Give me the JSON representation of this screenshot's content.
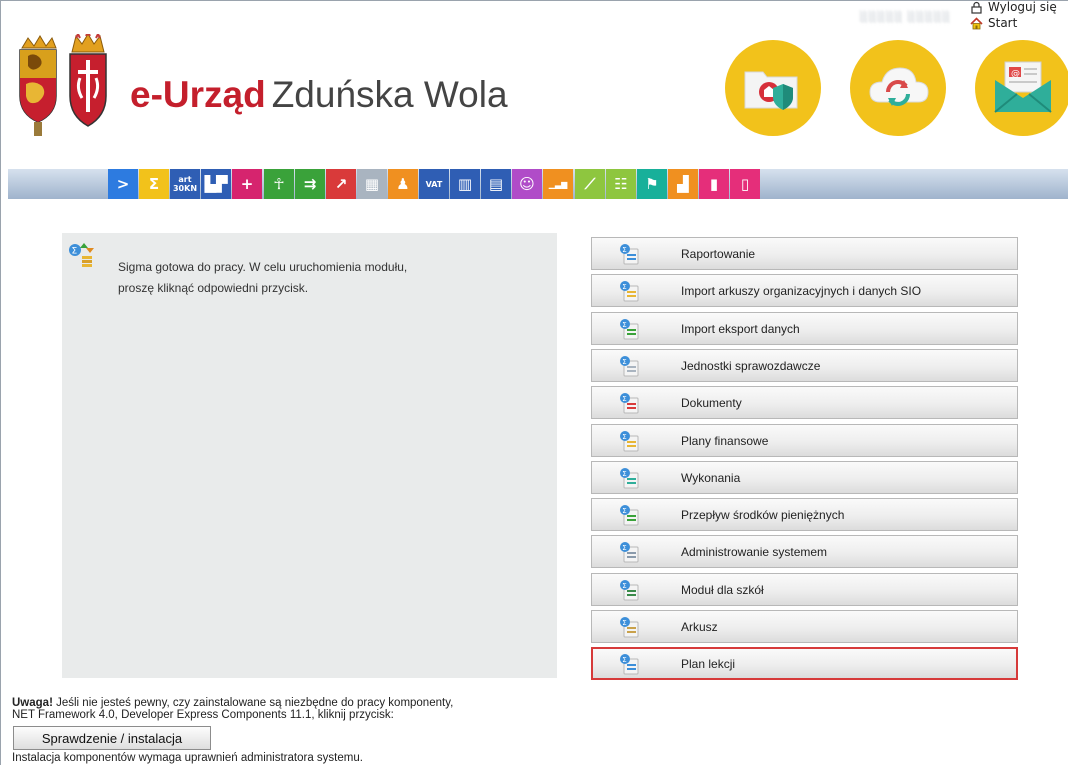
{
  "header": {
    "brand_main": "e-Urząd",
    "brand_city": "Zduńska Wola",
    "user_name": "░░░░░ ░░░░░",
    "logout_label": "Wyloguj się",
    "start_label": "Start",
    "circle_icons": [
      "secure-folder-icon",
      "cloud-sync-icon",
      "email-icon"
    ],
    "accent_color": "#f2c21b",
    "brand_color": "#c41f2c"
  },
  "toolbar": {
    "items": [
      {
        "name": "toolbar-arrow-button",
        "color": "#2d7be0",
        "glyph": ">"
      },
      {
        "name": "toolbar-sigma-button",
        "color": "#f2c21b",
        "glyph": "Σ"
      },
      {
        "name": "toolbar-art30kn-button",
        "color": "#2f5eb4",
        "glyph": "art 30KN"
      },
      {
        "name": "toolbar-buildings-button",
        "color": "#2f5eb4",
        "glyph": "▙▛"
      },
      {
        "name": "toolbar-plus-button",
        "color": "#d6246e",
        "glyph": "+"
      },
      {
        "name": "toolbar-people-button",
        "color": "#3aa23a",
        "glyph": "☥"
      },
      {
        "name": "toolbar-transfer-button",
        "color": "#3aa23a",
        "glyph": "⇉"
      },
      {
        "name": "toolbar-growth-button",
        "color": "#d93a3a",
        "glyph": "↗"
      },
      {
        "name": "toolbar-table-button",
        "color": "#a9b4c0",
        "glyph": "▦"
      },
      {
        "name": "toolbar-person-button",
        "color": "#f09020",
        "glyph": "♟"
      },
      {
        "name": "toolbar-vat-button",
        "color": "#2f5eb4",
        "glyph": "VAT"
      },
      {
        "name": "toolbar-book-button",
        "color": "#2f5eb4",
        "glyph": "▥"
      },
      {
        "name": "toolbar-book-search-button",
        "color": "#2f5eb4",
        "glyph": "▤"
      },
      {
        "name": "toolbar-kids-button",
        "color": "#b04cc8",
        "glyph": "☺"
      },
      {
        "name": "toolbar-bar-chart-button",
        "color": "#f09020",
        "glyph": "▁▃▆"
      },
      {
        "name": "toolbar-line-chart-button",
        "color": "#8ec63f",
        "glyph": "⟋"
      },
      {
        "name": "toolbar-list-button",
        "color": "#8ec63f",
        "glyph": "☷"
      },
      {
        "name": "toolbar-desk-button",
        "color": "#18b09a",
        "glyph": "⚑"
      },
      {
        "name": "toolbar-blocks-button",
        "color": "#f09020",
        "glyph": "▟"
      },
      {
        "name": "toolbar-label-button",
        "color": "#e52e7a",
        "glyph": "▮"
      },
      {
        "name": "toolbar-page-button",
        "color": "#e52e7a",
        "glyph": "▯"
      }
    ]
  },
  "info": {
    "line1": "Sigma gotowa do pracy. W celu uruchomienia modułu,",
    "line2": "proszę kliknąć odpowiedni przycisk."
  },
  "modules": [
    {
      "label": "Raportowanie",
      "icon": "report-icon"
    },
    {
      "label": "Import arkuszy organizacyjnych i danych SIO",
      "icon": "sio-import-icon"
    },
    {
      "label": "Import eksport danych",
      "icon": "import-export-icon"
    },
    {
      "label": "Jednostki sprawozdawcze",
      "icon": "units-icon"
    },
    {
      "label": "Dokumenty",
      "icon": "documents-icon"
    },
    {
      "label": "Plany finansowe",
      "icon": "financial-plans-icon"
    },
    {
      "label": "Wykonania",
      "icon": "executions-icon"
    },
    {
      "label": "Przepływ środków pieniężnych",
      "icon": "cash-flow-icon"
    },
    {
      "label": "Administrowanie systemem",
      "icon": "system-admin-icon"
    },
    {
      "label": "Moduł dla szkół",
      "icon": "school-module-icon"
    },
    {
      "label": "Arkusz",
      "icon": "sheet-icon"
    },
    {
      "label": "Plan lekcji",
      "icon": "lesson-plan-icon",
      "selected": true
    }
  ],
  "footer": {
    "warning_bold": "Uwaga!",
    "warning_text1": " Jeśli nie jesteś pewny, czy zainstalowane są niezbędne do pracy komponenty,",
    "warning_text2": "NET Framework 4.0, Developer Express Components 11.1, kliknij przycisk:",
    "check_button": "Sprawdzenie / instalacja",
    "install_note": "Instalacja komponentów wymaga uprawnień administratora systemu."
  }
}
